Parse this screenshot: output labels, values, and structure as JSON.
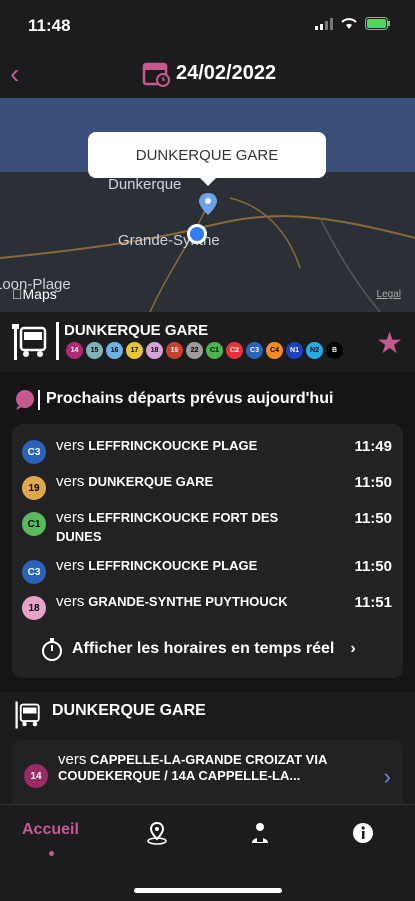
{
  "status": {
    "time": "11:48"
  },
  "header": {
    "date": "24/02/2022"
  },
  "map": {
    "popup": "DUNKERQUE GARE",
    "labels": {
      "city1": "Dunkerque",
      "city2": "Grande-Synthe",
      "city3": "Loon-Plage"
    },
    "maps_label": "Maps",
    "legal": "Legal"
  },
  "stop": {
    "name": "DUNKERQUE GARE",
    "lines": [
      {
        "label": "14",
        "color": "#b12a78"
      },
      {
        "label": "15",
        "color": "#7fb3b8"
      },
      {
        "label": "16",
        "color": "#70b2e5"
      },
      {
        "label": "17",
        "color": "#e7c43a"
      },
      {
        "label": "18",
        "color": "#d7a3d6"
      },
      {
        "label": "19",
        "color": "#c7412f"
      },
      {
        "label": "22",
        "color": "#9c9c9c"
      },
      {
        "label": "C1",
        "color": "#4bb44b"
      },
      {
        "label": "C2",
        "color": "#e63336"
      },
      {
        "label": "C3",
        "color": "#2a63b7"
      },
      {
        "label": "C4",
        "color": "#f28c28"
      },
      {
        "label": "N1",
        "color": "#1e3fbf"
      },
      {
        "label": "N2",
        "color": "#28a9e0"
      },
      {
        "label": "B",
        "color": "#000000"
      }
    ]
  },
  "departures": {
    "title": "Prochains départs prévus aujourd'hui",
    "items": [
      {
        "line": "C3",
        "color": "#2a63b7",
        "vers": "vers",
        "dest": "LEFFRINCKOUCKE PLAGE",
        "time": "11:49"
      },
      {
        "line": "19",
        "color": "#e0a84a",
        "vers": "vers",
        "dest": "DUNKERQUE GARE",
        "time": "11:50"
      },
      {
        "line": "C1",
        "color": "#5cb85c",
        "vers": "vers",
        "dest": "LEFFRINCKOUCKE FORT DES DUNES",
        "time": "11:50"
      },
      {
        "line": "C3",
        "color": "#2a63b7",
        "vers": "vers",
        "dest": "LEFFRINCKOUCKE PLAGE",
        "time": "11:50"
      },
      {
        "line": "18",
        "color": "#e5a3c9",
        "vers": "vers",
        "dest": "GRANDE-SYNTHE  PUYTHOUCK",
        "time": "11:51"
      }
    ],
    "realtime_label": "Afficher les horaires en temps réel"
  },
  "stop2": {
    "name": "DUNKERQUE GARE",
    "line": "14",
    "vers": "vers",
    "dest": "CAPPELLE-LA-GRANDE CROIZAT VIA COUDEKERQUE / 14A CAPPELLE-LA..."
  },
  "tabbar": {
    "home": "Accueil"
  }
}
